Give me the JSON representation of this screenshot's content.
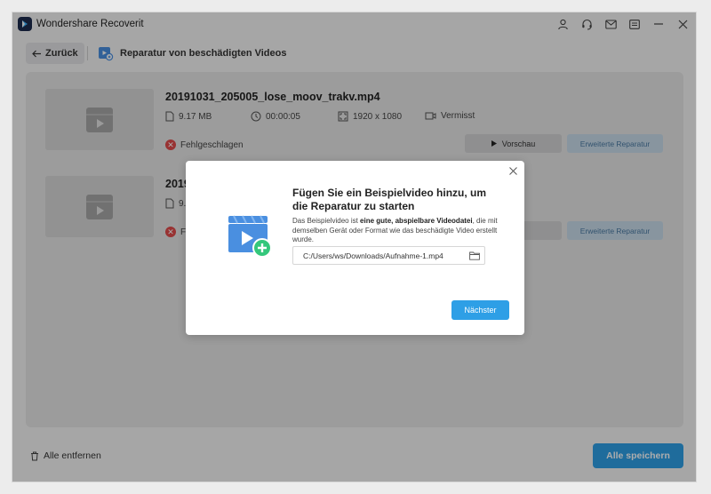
{
  "app": {
    "title": "Wondershare Recoverit"
  },
  "titlebar": {
    "icons": [
      "user-icon",
      "headset-icon",
      "mail-icon",
      "menu-icon",
      "minimize-icon",
      "close-icon"
    ]
  },
  "nav": {
    "back_label": "Zurück",
    "page_title": "Reparatur von beschädigten Videos"
  },
  "videos": [
    {
      "file_name": "20191031_205005_lose_moov_trakv.mp4",
      "size": "9.17  MB",
      "duration": "00:00:05",
      "resolution": "1920 x 1080",
      "device": "Vermisst",
      "status": "Fehlgeschlagen",
      "preview_label": "Vorschau",
      "advanced_label": "Erweiterte Reparatur"
    },
    {
      "file_name": "2019",
      "size": "9.",
      "status": "Fe",
      "preview_label": "hau",
      "advanced_label": "Erweiterte Reparatur"
    }
  ],
  "footer": {
    "remove_all_label": "Alle entfernen",
    "save_all_label": "Alle speichern"
  },
  "dialog": {
    "title": "Fügen Sie ein Beispielvideo hinzu, um die Reparatur zu starten",
    "desc_before": "Das Beispielvideo ist ",
    "desc_bold": "eine gute, abspielbare Videodatei",
    "desc_after": ", die mit demselben Gerät oder Format wie das beschädigte Video erstellt wurde.",
    "path_value": "C:/Users/ws/Downloads/Aufnahme-1.mp4",
    "next_label": "Nächster"
  },
  "colors": {
    "accent": "#2e9fe6",
    "error": "#e14a4a",
    "advanced_button_bg": "#c9dceb"
  }
}
